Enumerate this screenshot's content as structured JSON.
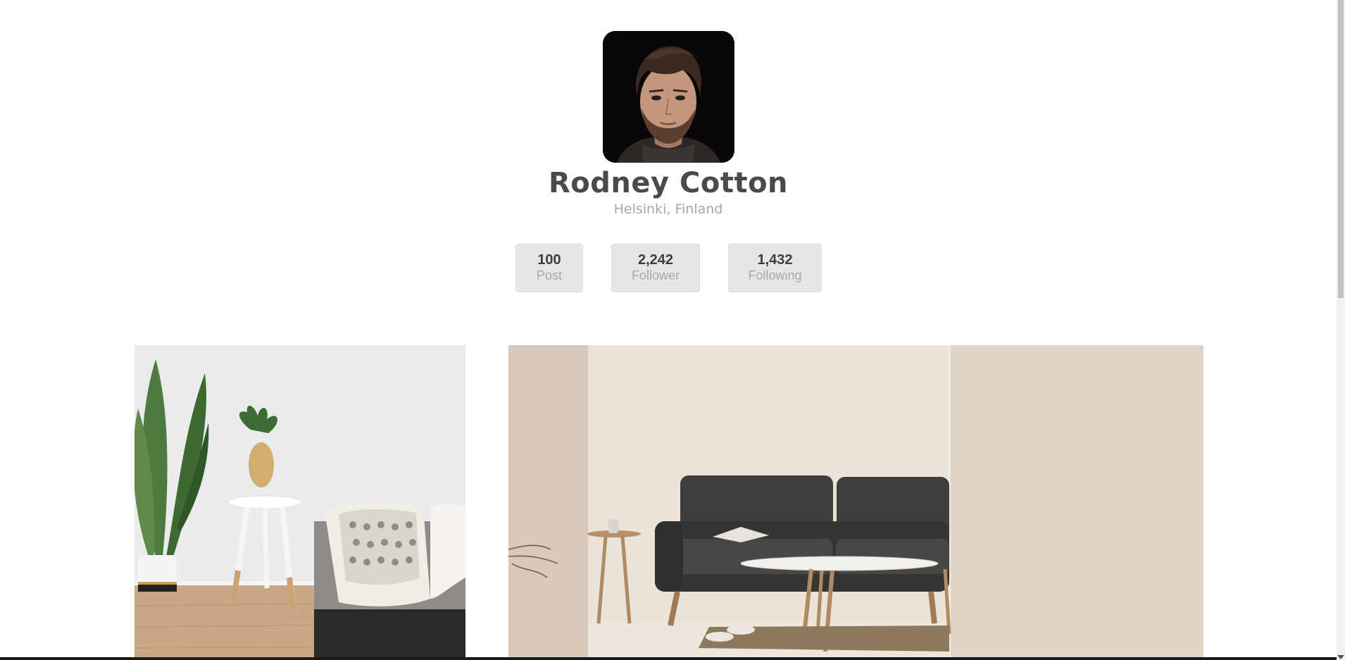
{
  "profile": {
    "name": "Rodney Cotton",
    "location": "Helsinki, Finland",
    "avatar_icon": "profile-photo"
  },
  "stats": [
    {
      "value": "100",
      "label": "Post"
    },
    {
      "value": "2,242",
      "label": "Follower"
    },
    {
      "value": "1,432",
      "label": "Following"
    }
  ],
  "gallery": [
    {
      "icon": "living-room-plant-photo"
    },
    {
      "icon": "grey-sofa-photo"
    }
  ],
  "colors": {
    "name_text": "#4a4a4a",
    "location_text": "#a6a6a6",
    "stat_background": "#e6e6e6",
    "stat_value": "#3d3d3d",
    "stat_label": "#a9a9a9"
  }
}
